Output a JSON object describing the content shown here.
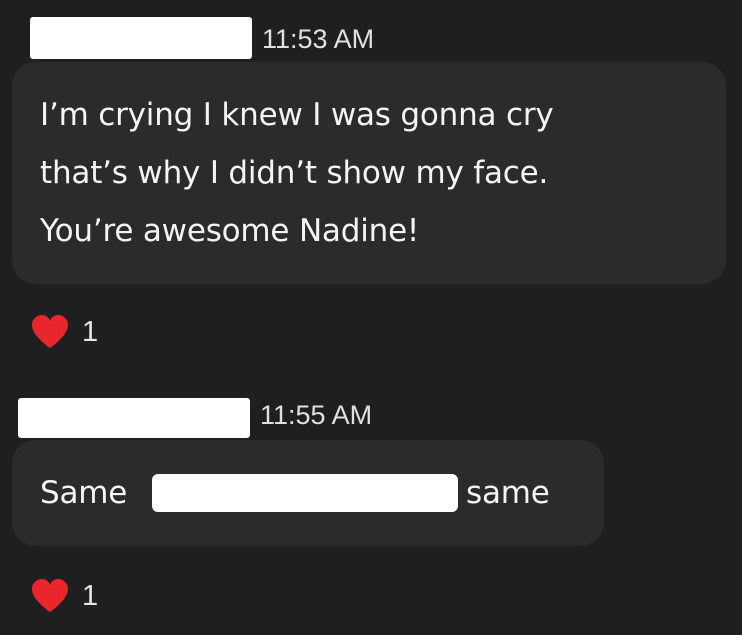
{
  "messages": [
    {
      "timestamp": "11:53 AM",
      "lines": [
        "I’m crying I knew I was gonna cry",
        "that’s why I didn’t show my face.",
        "You’re awesome Nadine!"
      ],
      "reaction": {
        "icon": "heart-icon",
        "count": "1"
      }
    },
    {
      "timestamp": "11:55 AM",
      "text_before": "Same",
      "text_after": "same",
      "reaction": {
        "icon": "heart-icon",
        "count": "1"
      }
    }
  ],
  "colors": {
    "background": "#1f1f1f",
    "bubble": "#2b2b2b",
    "heart": "#e8262b"
  }
}
